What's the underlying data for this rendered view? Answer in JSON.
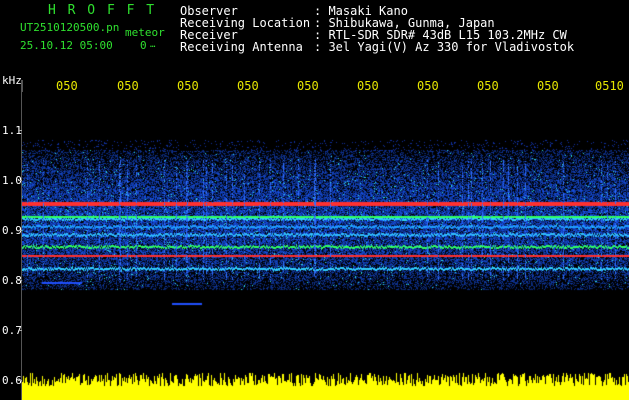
{
  "header": {
    "app_title": "H R O F F T",
    "file_name": "UT2510120500.pn",
    "mode": "meteor",
    "date_time": "25.10.12 05:00",
    "count": "0",
    "ellipsis": "…",
    "info_labels": [
      "Observer",
      "Receiving Location",
      "Receiver",
      "Receiving Antenna"
    ],
    "info_values": [
      ": Masaki Kano",
      ": Shibukawa, Gunma, Japan",
      ": RTL-SDR SDR# 43dB L15 103.2MHz CW",
      ": 3el Yagi(V) Az 330 for Vladivostok"
    ]
  },
  "axis": {
    "unit": "kHz",
    "y_ticks": [
      "1.1",
      "1.0",
      "0.9",
      "0.8",
      "0.7",
      "0.6"
    ],
    "x_ticks": [
      "050",
      "050",
      "050",
      "050",
      "050",
      "050",
      "050",
      "050",
      "050",
      "0510"
    ]
  },
  "colors": {
    "background": "#000000",
    "text_green": "#2fe02f",
    "text_white": "#ffffff",
    "text_yellow": "#e6e600",
    "noise": "#1040c0",
    "signal_red": "#ff3030",
    "signal_green": "#30ff60",
    "audio": "#ffff00"
  }
}
